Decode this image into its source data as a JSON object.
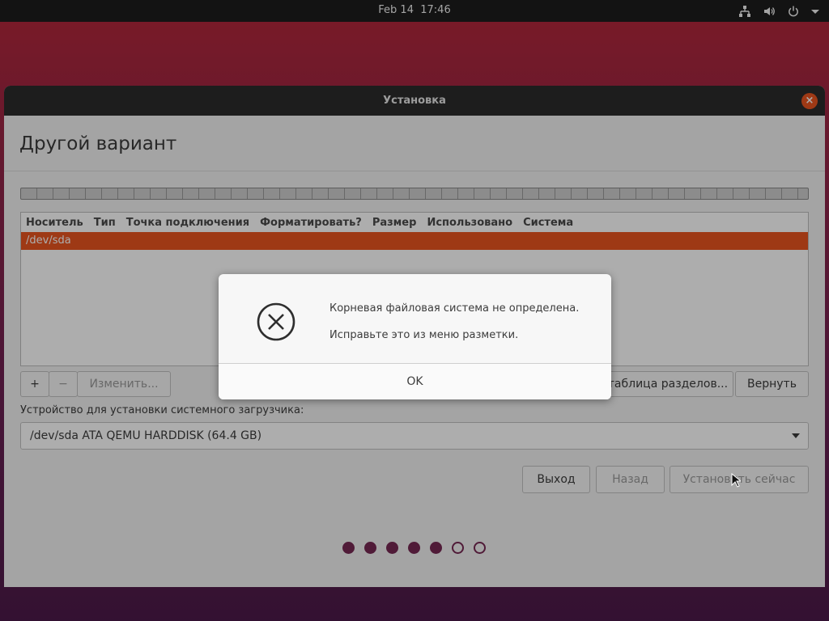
{
  "topbar": {
    "date": "Feb 14",
    "time": "17:46"
  },
  "window": {
    "title": "Установка",
    "heading": "Другой вариант",
    "table": {
      "columns": [
        "Носитель",
        "Тип",
        "Точка подключения",
        "Форматировать?",
        "Размер",
        "Использовано",
        "Система"
      ],
      "rows": [
        {
          "device": "/dev/sda"
        }
      ]
    },
    "partition_buttons": {
      "add": "+",
      "remove": "−",
      "change": "Изменить...",
      "new_table": "Новая таблица разделов...",
      "revert": "Вернуть"
    },
    "bootloader": {
      "label": "Устройство для установки системного загрузчика:",
      "selected": "/dev/sda ATA QEMU HARDDISK (64.4 GB)"
    },
    "nav": {
      "quit": "Выход",
      "back": "Назад",
      "install": "Установить сейчас"
    },
    "progress": {
      "total_steps": 7,
      "completed_steps": 5
    }
  },
  "dialog": {
    "message": "Корневая файловая система не определена.",
    "hint": "Исправьте это из меню разметки.",
    "ok": "OK"
  },
  "colors": {
    "accent": "#e95420",
    "aubergine": "#772953",
    "titlebar": "#2c2c2c"
  }
}
